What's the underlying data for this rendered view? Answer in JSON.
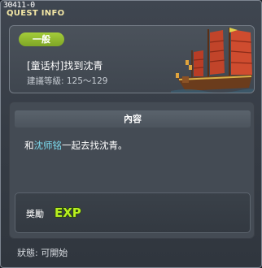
{
  "window": {
    "quest_id": "30411-0",
    "title": "QUEST INFO"
  },
  "header": {
    "category": "一般",
    "quest_name": "[童话村]找到沈青",
    "level_text": "建議等級: 125～129"
  },
  "content": {
    "header_label": "內容",
    "desc_prefix": "和",
    "desc_npc": "沈师铭",
    "desc_suffix": "一起去找沈青。"
  },
  "reward": {
    "label": "獎勵",
    "exp_label": "EXP"
  },
  "status": "狀態: 可開始",
  "colors": {
    "title": "#f3e7a5",
    "badge": "#8db82e",
    "npc_highlight": "#7cdcf0",
    "exp": "#b8f020"
  },
  "icons": {
    "close": "close-icon",
    "illustration": "sailing-ship-illustration",
    "exp": "exp-icon"
  }
}
